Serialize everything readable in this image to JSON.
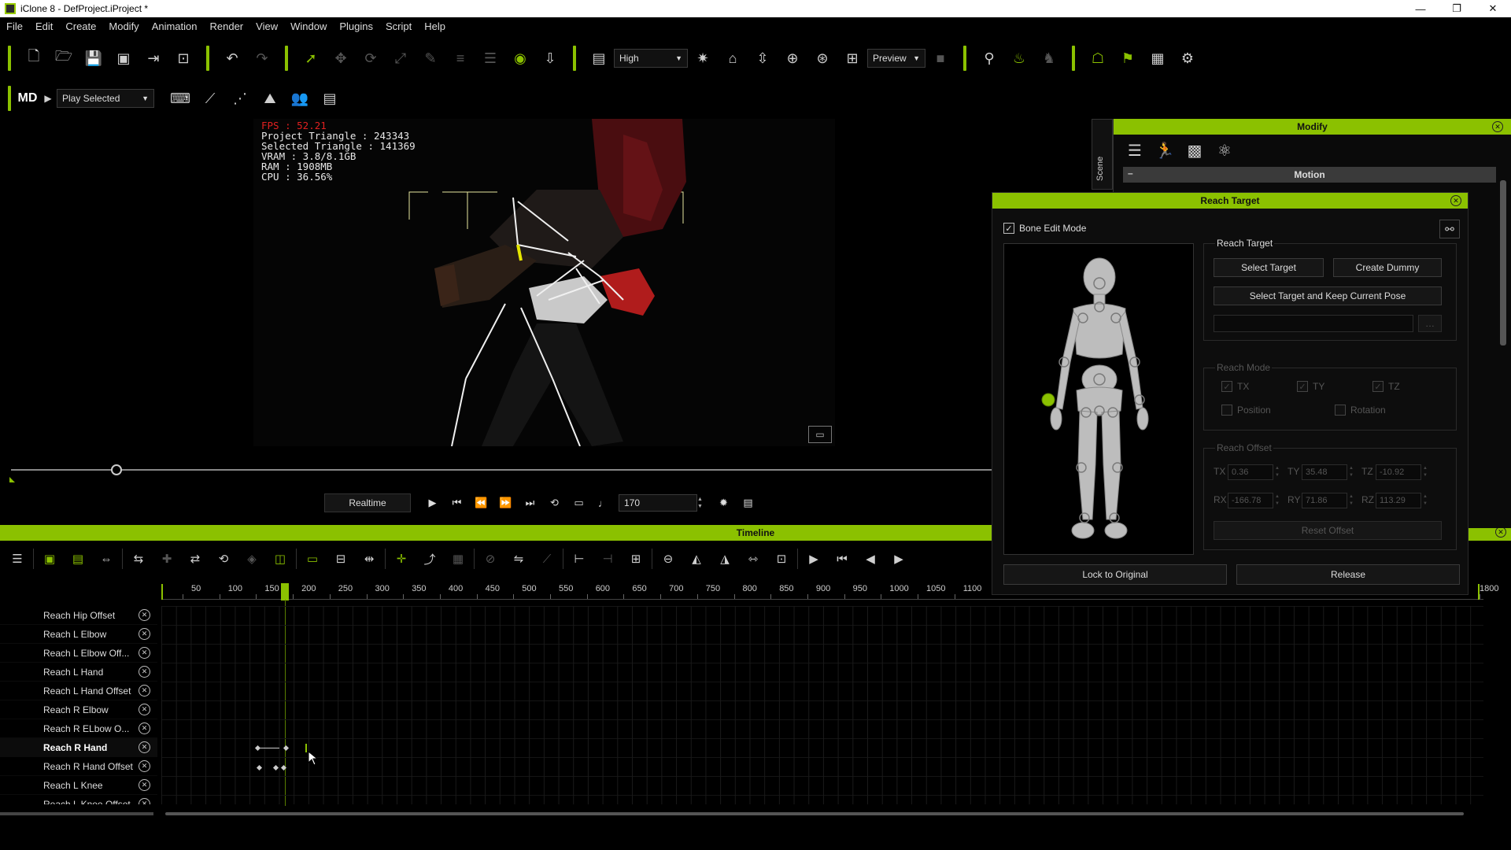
{
  "window": {
    "title": "iClone 8 - DefProject.iProject *",
    "controls": [
      "—",
      "❐",
      "✕"
    ]
  },
  "menu": [
    "File",
    "Edit",
    "Create",
    "Modify",
    "Animation",
    "Render",
    "View",
    "Window",
    "Plugins",
    "Script",
    "Help"
  ],
  "toolbar": {
    "quality": "High",
    "preview": "Preview",
    "play_mode": "Play Selected"
  },
  "viewport": {
    "stats": {
      "fps": "FPS : 52.21",
      "project_triangle": "Project Triangle : 243343",
      "selected_triangle": "Selected Triangle : 141369",
      "vram": "VRAM : 3.8/8.1GB",
      "ram": "RAM : 1908MB",
      "cpu": "CPU : 36.56%"
    }
  },
  "playback": {
    "mode": "Realtime",
    "frame": "170"
  },
  "timeline": {
    "title": "Timeline",
    "ruler_ticks": [
      "50",
      "100",
      "150",
      "200",
      "250",
      "300",
      "350",
      "400",
      "450",
      "500",
      "550",
      "600",
      "650",
      "700",
      "750",
      "800",
      "850",
      "900",
      "950",
      "1000",
      "1050",
      "1100",
      "1800"
    ],
    "tracks": [
      {
        "label": "Reach Hip Offset",
        "selected": false
      },
      {
        "label": "Reach L Elbow",
        "selected": false
      },
      {
        "label": "Reach L Elbow Off...",
        "selected": false
      },
      {
        "label": "Reach L Hand",
        "selected": false
      },
      {
        "label": "Reach L Hand Offset",
        "selected": false
      },
      {
        "label": "Reach R Elbow",
        "selected": false
      },
      {
        "label": "Reach R ELbow O...",
        "selected": false
      },
      {
        "label": "Reach R Hand",
        "selected": true
      },
      {
        "label": "Reach R Hand Offset",
        "selected": false
      },
      {
        "label": "Reach L Knee",
        "selected": false
      },
      {
        "label": "Reach L Knee Offset",
        "selected": false
      }
    ]
  },
  "modify_panel": {
    "title": "Modify",
    "scene_tab": "Scene",
    "section": "Motion"
  },
  "reach_target": {
    "title": "Reach Target",
    "bone_edit_mode": "Bone Edit Mode",
    "group_reach_target": "Reach Target",
    "select_target": "Select Target",
    "create_dummy": "Create  Dummy",
    "select_keep_pose": "Select Target and Keep Current Pose",
    "reach_mode": "Reach Mode",
    "tx": "TX",
    "ty": "TY",
    "tz": "TZ",
    "position": "Position",
    "rotation": "Rotation",
    "reach_offset": "Reach Offset",
    "offset_tx": "0.36",
    "offset_ty": "35.48",
    "offset_tz": "-10.92",
    "rx": "RX",
    "ry": "RY",
    "rz": "RZ",
    "offset_rx": "-166.78",
    "offset_ry": "71.86",
    "offset_rz": "113.29",
    "reset_offset": "Reset Offset",
    "lock_to_original": "Lock to Original",
    "release": "Release"
  },
  "colors": {
    "accent": "#8bc100",
    "fps": "#e02020"
  }
}
